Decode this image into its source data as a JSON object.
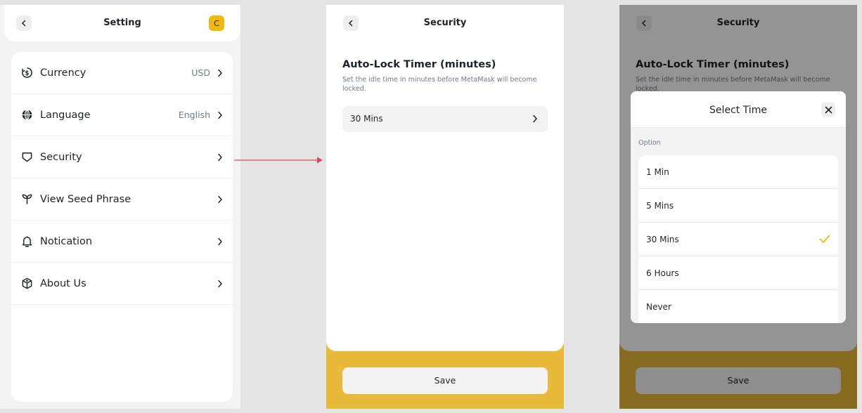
{
  "screen1": {
    "title": "Setting",
    "avatar_letter": "C",
    "items": [
      {
        "label": "Currency",
        "value": "USD",
        "icon": "currency-icon"
      },
      {
        "label": "Language",
        "value": "English",
        "icon": "globe-icon"
      },
      {
        "label": "Security",
        "value": "",
        "icon": "shield-icon"
      },
      {
        "label": "View Seed Phrase",
        "value": "",
        "icon": "seed-icon"
      },
      {
        "label": "Notication",
        "value": "",
        "icon": "bell-icon"
      },
      {
        "label": "About Us",
        "value": "",
        "icon": "cube-icon"
      }
    ]
  },
  "screen2": {
    "title": "Security",
    "section_title": "Auto-Lock Timer (minutes)",
    "section_desc": "Set the idle time in minutes before MetaMask will become locked.",
    "selected_value": "30 Mins",
    "save_label": "Save"
  },
  "screen3": {
    "title": "Security",
    "section_title": "Auto-Lock Timer (minutes)",
    "section_desc": "Set the idle time in minutes before MetaMask will become locked.",
    "save_label": "Save",
    "modal": {
      "title": "Select Time",
      "section_label": "Option",
      "options": [
        {
          "label": "1 Min",
          "selected": false
        },
        {
          "label": "5 Mins",
          "selected": false
        },
        {
          "label": "30 Mins",
          "selected": true
        },
        {
          "label": "6 Hours",
          "selected": false
        },
        {
          "label": "Never",
          "selected": false
        }
      ]
    }
  },
  "colors": {
    "accent": "#f0b90b",
    "footer": "#e9b93a",
    "arrow": "#d9485f",
    "text": "#1e2329",
    "muted": "#707a8a"
  }
}
